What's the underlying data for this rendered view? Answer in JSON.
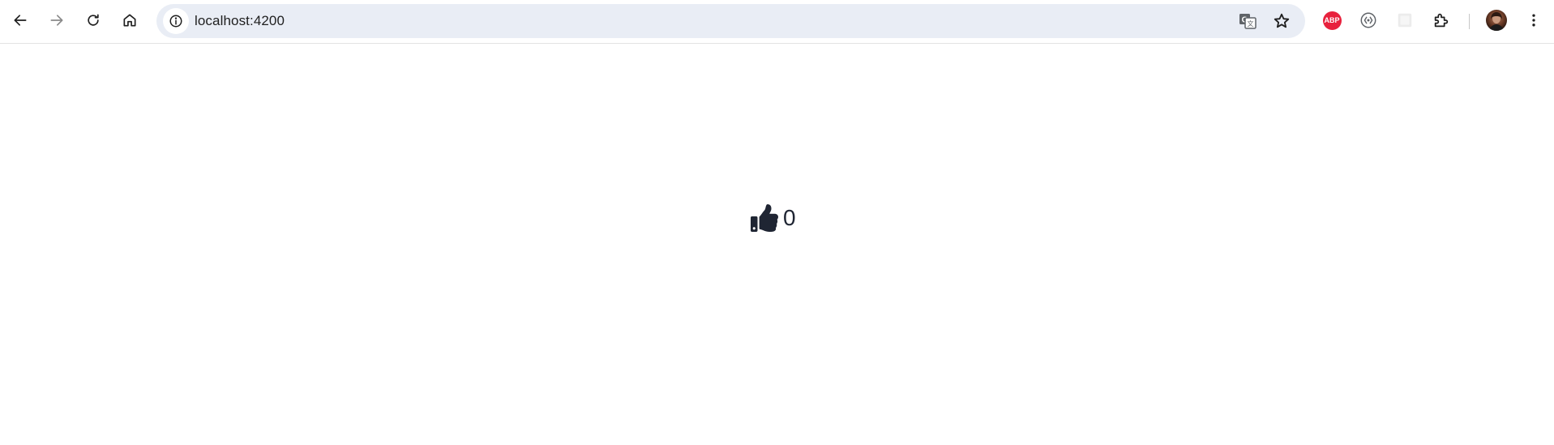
{
  "browser": {
    "url": "localhost:4200",
    "icons": {
      "back": "arrow-left-icon",
      "forward": "arrow-right-icon",
      "reload": "reload-icon",
      "home": "home-icon",
      "site_info": "info-icon",
      "translate": "translate-icon",
      "bookmark": "star-icon",
      "adblock": "adblock-plus-icon",
      "extension_2": "code-brackets-icon",
      "extension_3": "blank-extension-icon",
      "extensions": "puzzle-icon",
      "profile": "avatar",
      "menu": "kebab-menu-icon"
    },
    "adblock_label": "ABP"
  },
  "page": {
    "like_icon": "thumbs-up-icon",
    "like_count": "0"
  },
  "colors": {
    "omnibox_bg": "#e9edf5",
    "icon_color": "#1f1f1f",
    "like_color": "#1f2533",
    "abp_red": "#e8213d"
  }
}
